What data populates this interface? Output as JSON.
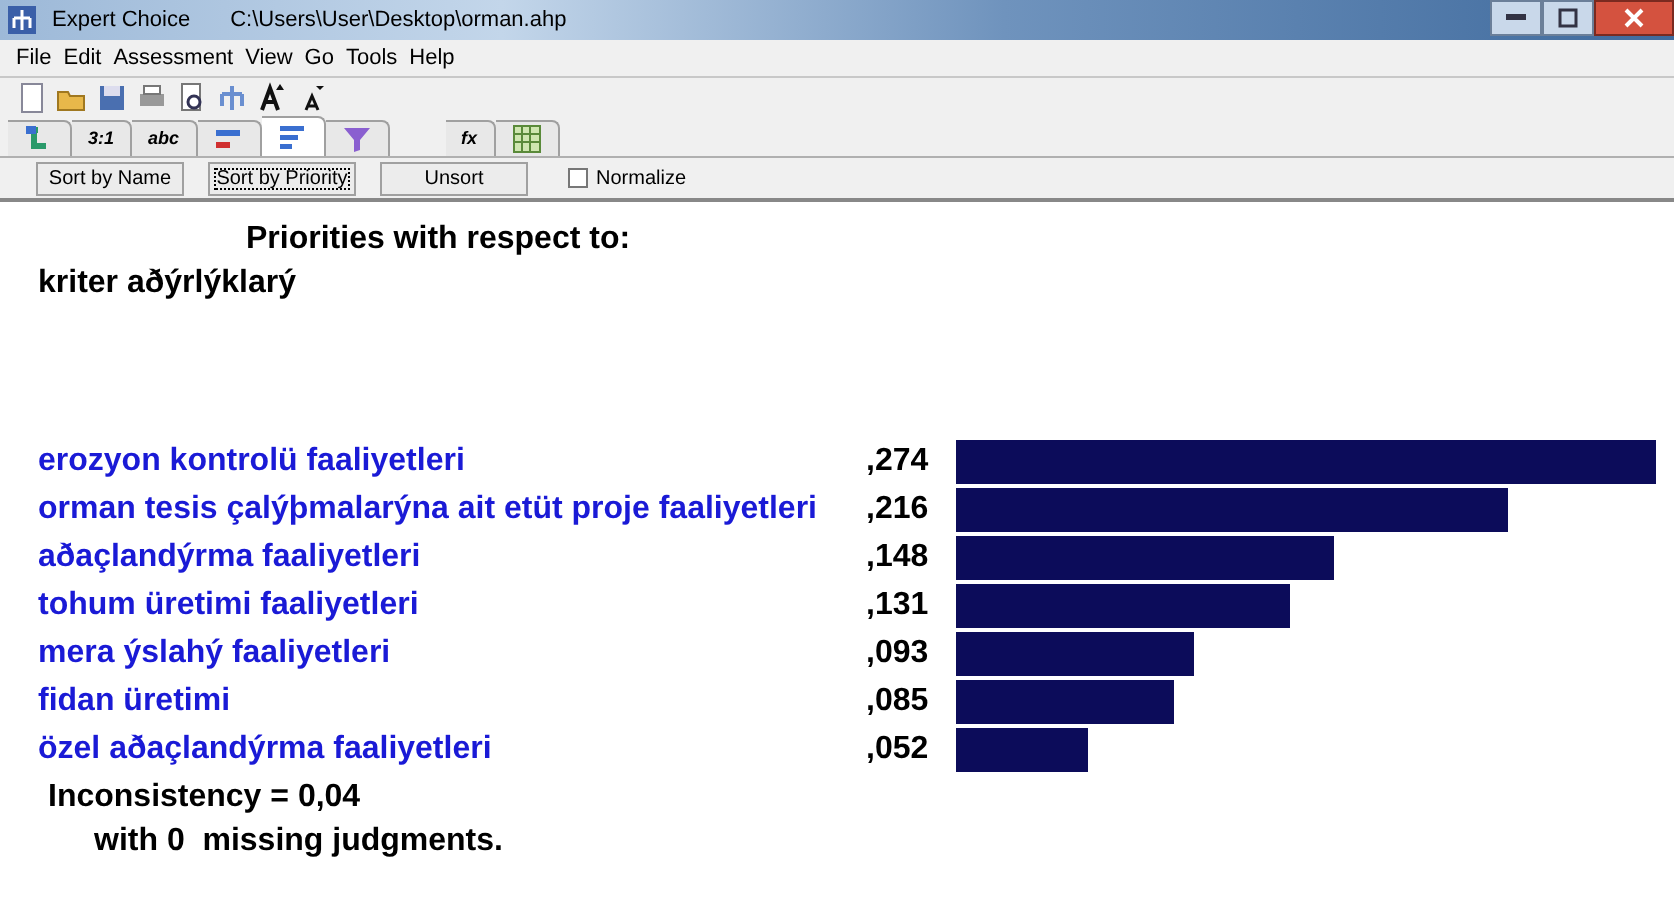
{
  "window": {
    "title": "Expert Choice",
    "path": "C:\\Users\\User\\Desktop\\orman.ahp"
  },
  "menu": [
    "File",
    "Edit",
    "Assessment",
    "View",
    "Go",
    "Tools",
    "Help"
  ],
  "toolbar": [
    {
      "kind": "new"
    },
    {
      "kind": "open"
    },
    {
      "kind": "save"
    },
    {
      "kind": "print"
    },
    {
      "kind": "preview"
    },
    {
      "kind": "tree"
    },
    {
      "kind": "font-up"
    },
    {
      "kind": "font-down"
    }
  ],
  "tabs": [
    {
      "kind": "tree",
      "selected": false
    },
    {
      "kind": "text",
      "label": "3:1",
      "selected": false
    },
    {
      "kind": "text",
      "label": "abc",
      "selected": false
    },
    {
      "kind": "bars-red",
      "selected": false
    },
    {
      "kind": "bars",
      "selected": true
    },
    {
      "kind": "funnel",
      "selected": false
    },
    {
      "kind": "text",
      "label": "fx",
      "selected": false
    },
    {
      "kind": "grid",
      "selected": false
    }
  ],
  "buttons": [
    {
      "label": "Sort by Name",
      "selected": false
    },
    {
      "label": "Sort by Priority",
      "selected": true
    },
    {
      "label": "Unsort",
      "selected": false
    }
  ],
  "normalize": {
    "label": "Normalize",
    "checked": false
  },
  "heading": "Priorities with respect to:",
  "goal": "kriter aðýrlýklarý",
  "priorities": [
    {
      "name": "erozyon kontrolü faaliyetleri",
      "value": ",274"
    },
    {
      "name": "orman tesis çalýþmalarýna ait etüt proje faaliyetleri",
      "value": ",216"
    },
    {
      "name": "aðaçlandýrma faaliyetleri",
      "value": ",148"
    },
    {
      "name": "tohum üretimi faaliyetleri",
      "value": ",131"
    },
    {
      "name": "mera ýslahý faaliyetleri",
      "value": ",093"
    },
    {
      "name": "fidan üretimi",
      "value": ",085"
    },
    {
      "name": "özel aðaçlandýrma faaliyetleri",
      "value": ",052"
    }
  ],
  "inconsistency": "Inconsistency = 0,04",
  "missing": "with 0  missing judgments."
}
